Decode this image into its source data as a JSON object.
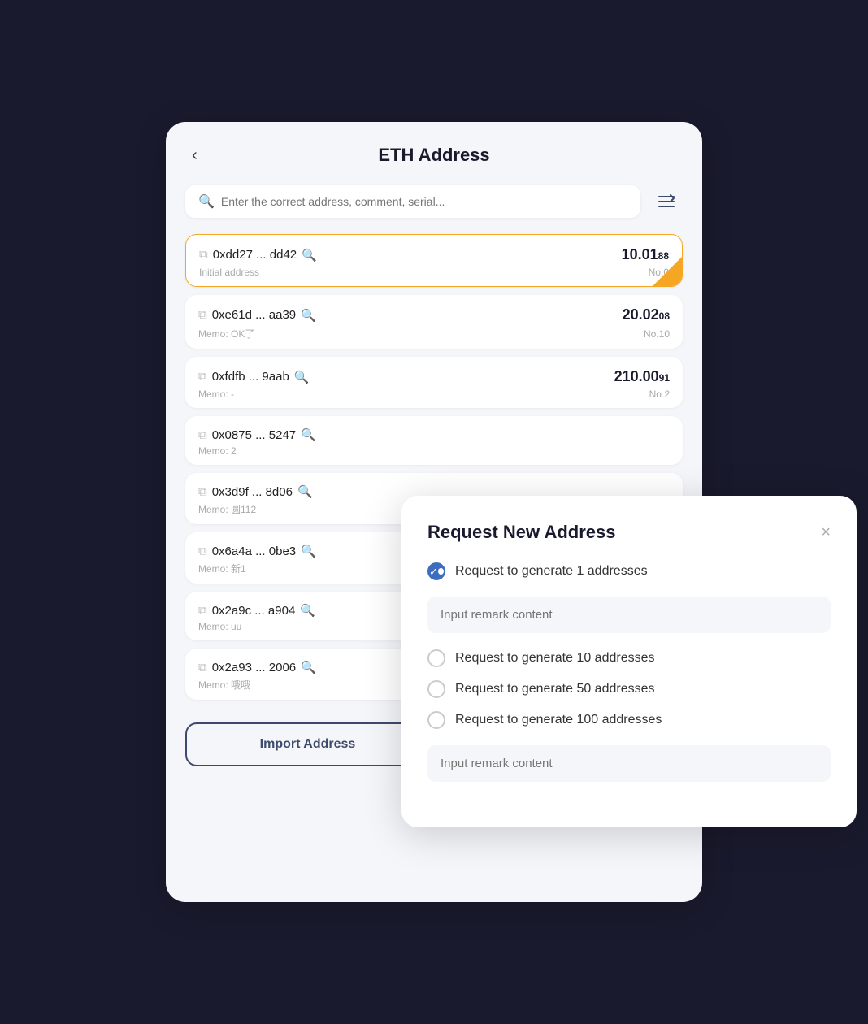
{
  "header": {
    "title": "ETH Address",
    "back_label": "‹"
  },
  "search": {
    "placeholder": "Enter the correct address, comment, serial...",
    "filter_icon": "≡↕"
  },
  "addresses": [
    {
      "id": "addr-1",
      "text": "0xdd27 ... dd42",
      "amount_main": "10.01",
      "amount_decimal": "88",
      "memo": "Initial address",
      "no_label": "No.0",
      "selected": true
    },
    {
      "id": "addr-2",
      "text": "0xe61d ... aa39",
      "amount_main": "20.02",
      "amount_decimal": "08",
      "memo": "Memo: OK了",
      "no_label": "No.10",
      "selected": false
    },
    {
      "id": "addr-3",
      "text": "0xfdfb ... 9aab",
      "amount_main": "210.00",
      "amount_decimal": "91",
      "memo": "Memo: -",
      "no_label": "No.2",
      "selected": false
    },
    {
      "id": "addr-4",
      "text": "0x0875 ... 5247",
      "amount_main": "",
      "amount_decimal": "",
      "memo": "Memo: 2",
      "no_label": "",
      "selected": false
    },
    {
      "id": "addr-5",
      "text": "0x3d9f ... 8d06",
      "amount_main": "",
      "amount_decimal": "",
      "memo": "Memo: 圆112",
      "no_label": "",
      "selected": false
    },
    {
      "id": "addr-6",
      "text": "0x6a4a ... 0be3",
      "amount_main": "",
      "amount_decimal": "",
      "memo": "Memo: 新1",
      "no_label": "",
      "selected": false
    },
    {
      "id": "addr-7",
      "text": "0x2a9c ... a904",
      "amount_main": "",
      "amount_decimal": "",
      "memo": "Memo: uu",
      "no_label": "",
      "selected": false
    },
    {
      "id": "addr-8",
      "text": "0x2a93 ... 2006",
      "amount_main": "",
      "amount_decimal": "",
      "memo": "Memo: 哦哦",
      "no_label": "",
      "selected": false
    }
  ],
  "footer": {
    "import_label": "Import Address",
    "request_label": "Request New Address"
  },
  "modal": {
    "title": "Request New Address",
    "close_label": "×",
    "options": [
      {
        "id": "opt-1",
        "label": "Request to generate 1 addresses",
        "checked": true
      },
      {
        "id": "opt-10",
        "label": "Request to generate 10 addresses",
        "checked": false
      },
      {
        "id": "opt-50",
        "label": "Request to generate 50 addresses",
        "checked": false
      },
      {
        "id": "opt-100",
        "label": "Request to generate 100 addresses",
        "checked": false
      }
    ],
    "remark_placeholder": "Input remark content"
  }
}
